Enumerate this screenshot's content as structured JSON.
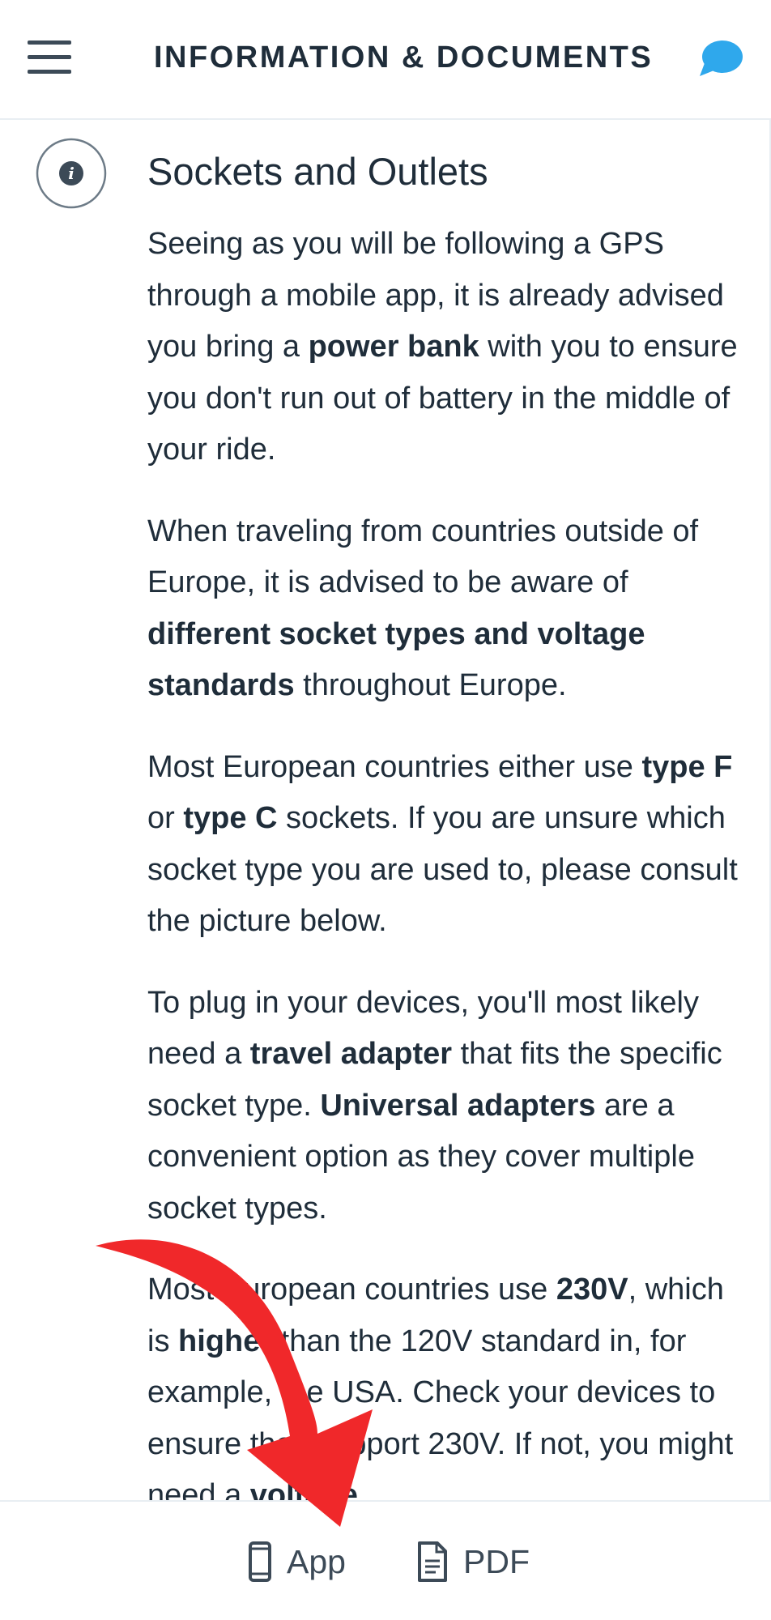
{
  "header": {
    "title": "INFORMATION & DOCUMENTS",
    "menu_icon": "hamburger-menu-icon",
    "chat_icon": "chat-bubble-icon",
    "chat_color": "#2fa8ec"
  },
  "section": {
    "icon": "info-icon",
    "title": "Sockets and Outlets",
    "paragraphs": [
      [
        {
          "t": "Seeing as you will be following a GPS through a mobile app, it is already advised you bring a ",
          "b": false
        },
        {
          "t": "power bank",
          "b": true
        },
        {
          "t": " with you to ensure you don't run out of battery in the middle of your ride.",
          "b": false
        }
      ],
      [
        {
          "t": "When traveling from countries outside of Europe, it is advised to be aware of ",
          "b": false
        },
        {
          "t": "different socket types and voltage standards",
          "b": true
        },
        {
          "t": " throughout Europe.",
          "b": false
        }
      ],
      [
        {
          "t": "Most European countries either use ",
          "b": false
        },
        {
          "t": "type F",
          "b": true
        },
        {
          "t": " or ",
          "b": false
        },
        {
          "t": "type C",
          "b": true
        },
        {
          "t": " sockets. If you are unsure which socket type you are used to, please consult the picture below.",
          "b": false
        }
      ],
      [
        {
          "t": "To plug in your devices, you'll most likely need a ",
          "b": false
        },
        {
          "t": "travel adapter",
          "b": true
        },
        {
          "t": " that fits the specific socket type. ",
          "b": false
        },
        {
          "t": "Universal adapters",
          "b": true
        },
        {
          "t": " are a convenient option as they cover multiple socket types.",
          "b": false
        }
      ],
      [
        {
          "t": "Most European countries use ",
          "b": false
        },
        {
          "t": "230V",
          "b": true
        },
        {
          "t": ", which is ",
          "b": false
        },
        {
          "t": "higher",
          "b": true
        },
        {
          "t": " than the 120V standard in, for example, the USA. Check your devices to ensure they support 230V. If not, you might need a ",
          "b": false
        },
        {
          "t": "voltage",
          "b": true
        }
      ]
    ]
  },
  "bottom_bar": {
    "app_label": "App",
    "app_icon": "smartphone-icon",
    "pdf_label": "PDF",
    "pdf_icon": "document-icon"
  },
  "overlay": {
    "arrow_icon": "red-arrow-annotation",
    "arrow_color": "#f0282a"
  }
}
